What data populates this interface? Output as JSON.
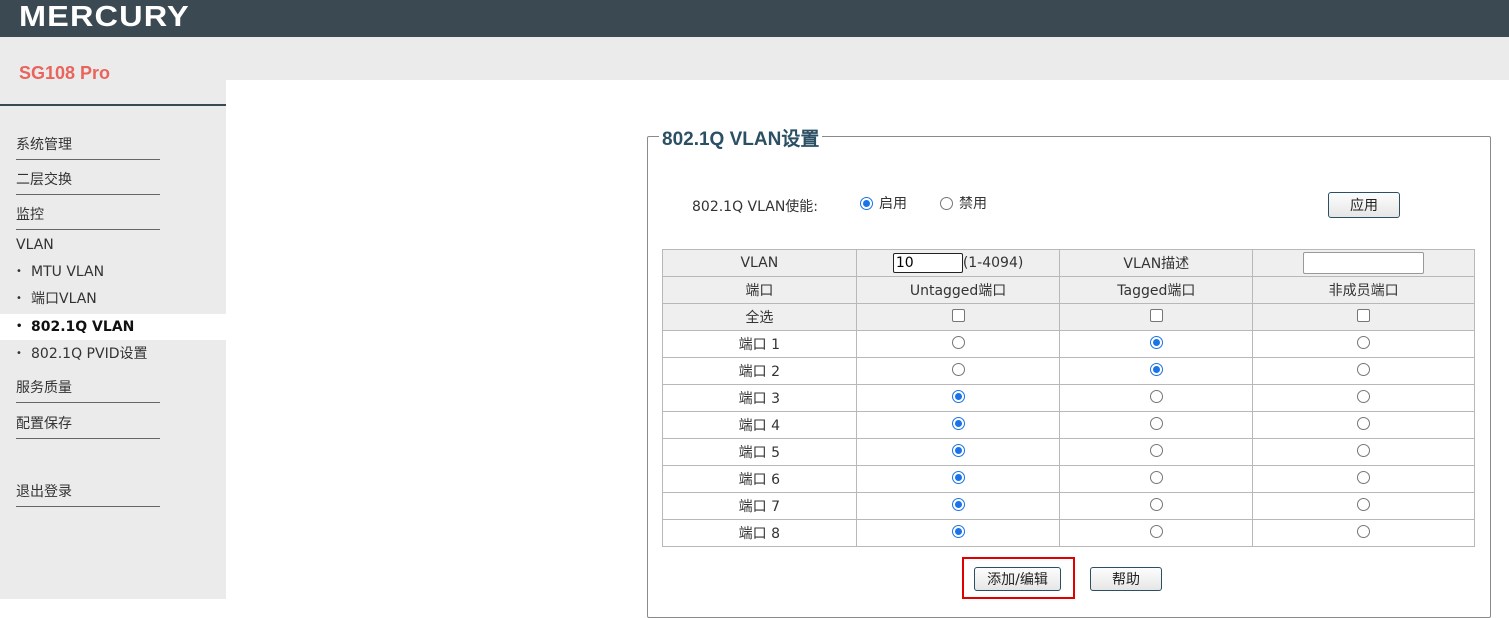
{
  "header": {
    "logo": "MERCURY"
  },
  "sidebar": {
    "model": "SG108 Pro",
    "menu": [
      {
        "label": "系统管理"
      },
      {
        "label": "二层交换"
      },
      {
        "label": "监控"
      }
    ],
    "vlan_head": "VLAN",
    "vlan_items": [
      {
        "label": "MTU VLAN"
      },
      {
        "label": "端口VLAN"
      },
      {
        "label": "802.1Q VLAN"
      },
      {
        "label": "802.1Q PVID设置"
      }
    ],
    "menu2": [
      {
        "label": "服务质量"
      },
      {
        "label": "配置保存"
      }
    ],
    "logout": "退出登录"
  },
  "panel": {
    "title": "802.1Q VLAN设置",
    "enable_label": "802.1Q VLAN使能:",
    "enable_on": "启用",
    "enable_off": "禁用",
    "enable_state": "on",
    "apply_button": "应用"
  },
  "table": {
    "vlan_label": "VLAN",
    "vlan_id_value": "10",
    "vlan_range": "(1-4094)",
    "desc_label": "VLAN描述",
    "desc_value": "",
    "col_port": "端口",
    "col_untagged": "Untagged端口",
    "col_tagged": "Tagged端口",
    "col_nonmember": "非成员端口",
    "select_all": "全选",
    "ports": [
      {
        "name": "端口 1",
        "mode": "tagged"
      },
      {
        "name": "端口 2",
        "mode": "tagged"
      },
      {
        "name": "端口 3",
        "mode": "untagged"
      },
      {
        "name": "端口 4",
        "mode": "untagged"
      },
      {
        "name": "端口 5",
        "mode": "untagged"
      },
      {
        "name": "端口 6",
        "mode": "untagged"
      },
      {
        "name": "端口 7",
        "mode": "untagged"
      },
      {
        "name": "端口 8",
        "mode": "untagged"
      }
    ]
  },
  "actions": {
    "add_edit": "添加/编辑",
    "help": "帮助"
  }
}
